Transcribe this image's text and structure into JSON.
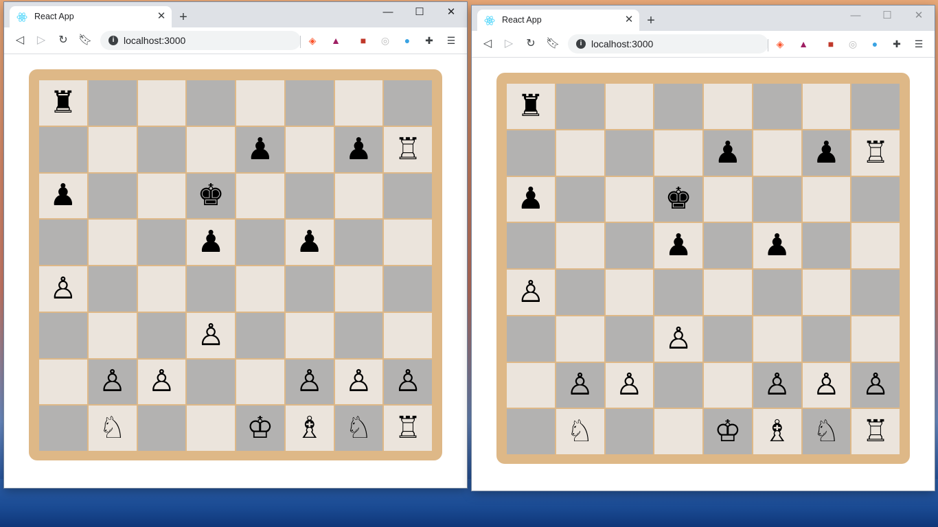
{
  "colors": {
    "board_frame": "#deb887",
    "light_square": "#ebe4dc",
    "dark_square": "#b3b2b1",
    "titlebar": "#dee1e6"
  },
  "windows": [
    {
      "tab_title": "React App",
      "url": "localhost:3000",
      "window_controls": [
        "—",
        "☐",
        "✕"
      ],
      "new_tab": "+",
      "tab_close": "✕"
    },
    {
      "tab_title": "React App",
      "url": "localhost:3000",
      "window_controls": [
        "—",
        "☐",
        "✕"
      ],
      "new_tab": "+",
      "tab_close": "✕"
    }
  ],
  "board": [
    [
      "♜",
      "",
      "",
      "",
      "",
      "",
      "",
      ""
    ],
    [
      "",
      "",
      "",
      "",
      "♟",
      "",
      "♟",
      "♖"
    ],
    [
      "♟",
      "",
      "",
      "♚",
      "",
      "",
      "",
      ""
    ],
    [
      "",
      "",
      "",
      "♟",
      "",
      "♟",
      "",
      ""
    ],
    [
      "♙",
      "",
      "",
      "",
      "",
      "",
      "",
      ""
    ],
    [
      "",
      "",
      "",
      "♙",
      "",
      "",
      "",
      ""
    ],
    [
      "",
      "♙",
      "♙",
      "",
      "",
      "♙",
      "♙",
      "♙"
    ],
    [
      "",
      "♘",
      "",
      "",
      "♔",
      "♗",
      "♘",
      "♖"
    ]
  ],
  "extensions": [
    "brave-lion-icon",
    "bat-triangle-icon",
    "red-extension-icon",
    "grey-circle-icon",
    "blue-search-icon",
    "puzzle-icon",
    "menu-icon"
  ]
}
